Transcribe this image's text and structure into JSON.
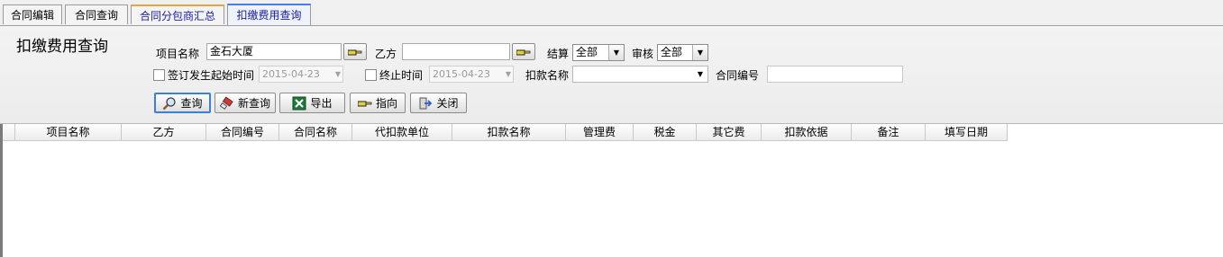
{
  "tabs": [
    {
      "label": "合同编辑"
    },
    {
      "label": "合同查询"
    },
    {
      "label": "合同分包商汇总"
    },
    {
      "label": "扣缴费用查询"
    }
  ],
  "form": {
    "title": "扣缴费用查询",
    "project_name_label": "项目名称",
    "project_name_value": "金石大厦",
    "party_b_label": "乙方",
    "party_b_value": "",
    "settlement_label": "结算",
    "settlement_value": "全部",
    "audit_label": "审核",
    "audit_value": "全部",
    "sign_start_label": "签订发生起始时间",
    "sign_start_value": "2015-04-23",
    "end_time_label": "终止时间",
    "end_time_value": "2015-04-23",
    "deduction_name_label": "扣款名称",
    "deduction_name_value": "",
    "contract_no_label": "合同编号",
    "contract_no_value": ""
  },
  "buttons": {
    "query": "查询",
    "new_query": "新查询",
    "export": "导出",
    "point": "指向",
    "close": "关闭"
  },
  "grid": {
    "columns": [
      "项目名称",
      "乙方",
      "合同编号",
      "合同名称",
      "代扣款单位",
      "扣款名称",
      "管理费",
      "税金",
      "其它费",
      "扣款依据",
      "备注",
      "填写日期"
    ]
  },
  "colors": {
    "tab_orange": "#e8a33c",
    "tab_active_blue": "#4a7ee0",
    "focus_blue": "#3c7fd6"
  }
}
